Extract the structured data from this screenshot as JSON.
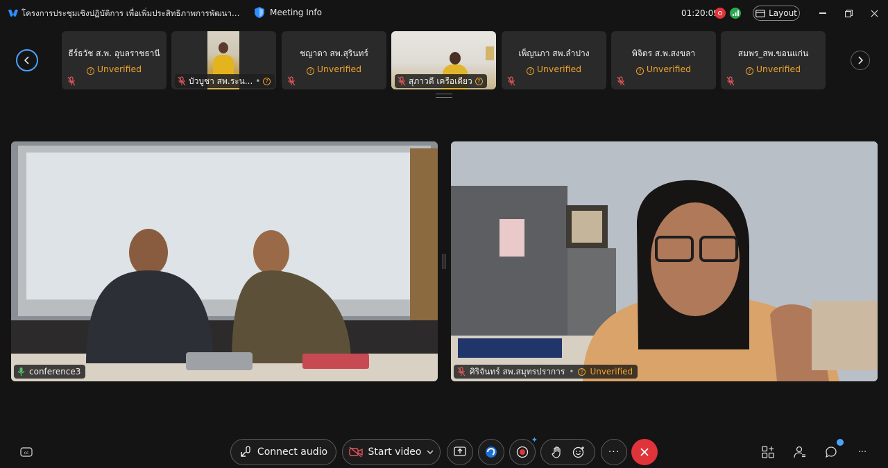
{
  "title_bar": {
    "meeting_title": "โครงการประชุมเชิงปฏิบัติการ เพื่อเพิ่มประสิทธิภาพการพัฒนาระบ...",
    "meeting_info_label": "Meeting Info",
    "clock": "01:20:09",
    "layout_label": "Layout"
  },
  "participants_strip": [
    {
      "name": "ธีร์ธวัช ส.พ. อุบลราชธานี",
      "status": "Unverified",
      "video": false
    },
    {
      "name": "บัวบูชา สพ.ระน...",
      "status": "",
      "video": true
    },
    {
      "name": "ชญาดา สพ.สุรินทร์",
      "status": "Unverified",
      "video": false
    },
    {
      "name": "สุภาวดี เครือเดียว",
      "status": "",
      "video": true
    },
    {
      "name": "เพ็ญนภา สพ.ลำปาง",
      "status": "Unverified",
      "video": false
    },
    {
      "name": "พิจิตร ส.พ.สงขลา",
      "status": "Unverified",
      "video": false
    },
    {
      "name": "สมพร_สพ.ขอนแก่น",
      "status": "Unverified",
      "video": false
    }
  ],
  "main_videos": {
    "left": {
      "name": "conference3"
    },
    "right": {
      "name": "ศิริจันทร์ สพ.สมุทรปราการ",
      "status": "Unverified"
    }
  },
  "controls": {
    "connect_audio": "Connect audio",
    "start_video": "Start video"
  },
  "colors": {
    "accent_blue": "#4aa3ff",
    "unverified": "#f0a32a",
    "end_call": "#e0343b",
    "mic_muted": "#e0565c",
    "mic_active": "#4cc46a"
  }
}
